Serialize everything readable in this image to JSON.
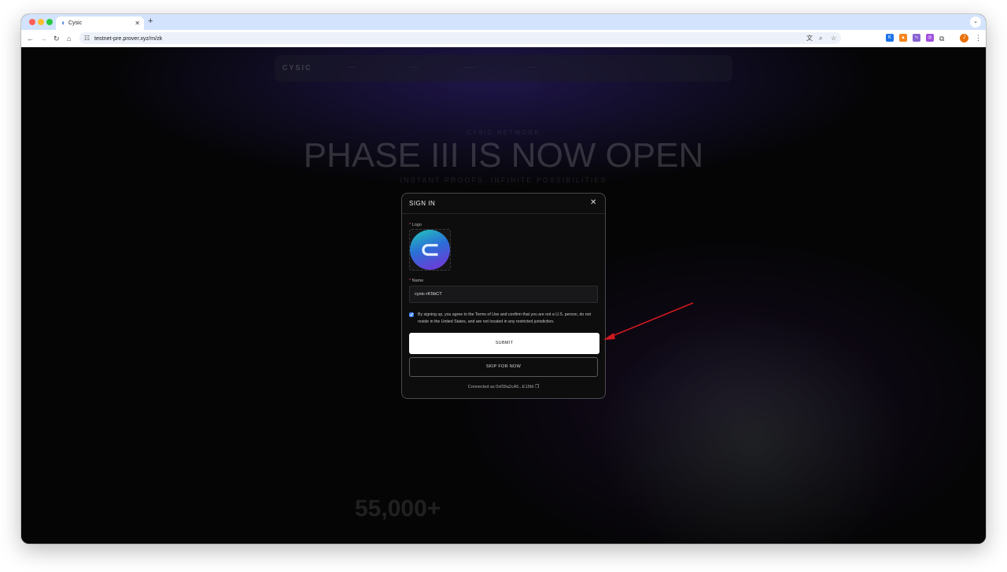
{
  "browser": {
    "tab_title": "Cysic",
    "url": "testnet-pre.prover.xyz/m/zk"
  },
  "background": {
    "nav_logo": "CYSIC",
    "top_link": "CYSIC NETWORK",
    "headline": "PHASE III IS NOW OPEN",
    "subheadline": "INSTANT PROOFS, INFINITE POSSIBILITIES",
    "stat_value": "55,000+"
  },
  "modal": {
    "title": "SIGN IN",
    "logo_label": "Logo",
    "name_label": "Name",
    "name_value": "cysic-rK5bCT",
    "agreement": "By signing up, you agree to the Terms of Use and confirm that you are not a U.S. person, do not reside in the United States, and are not located in any restricted jurisdiction.",
    "submit_label": "SUBMIT",
    "skip_label": "SKIP FOR NOW",
    "connected_text": "Connected as 0xf39a2cA5...E15fd"
  },
  "colors": {
    "annotation_arrow": "#d0191f",
    "required_marker": "#ff4d4f"
  },
  "icons": [
    "close-icon",
    "copy-icon",
    "back-icon",
    "forward-icon",
    "reload-icon",
    "home-icon",
    "translate-icon",
    "zoom-icon",
    "bookmark-star-icon",
    "extensions-puzzle-icon",
    "kebab-menu-icon"
  ]
}
